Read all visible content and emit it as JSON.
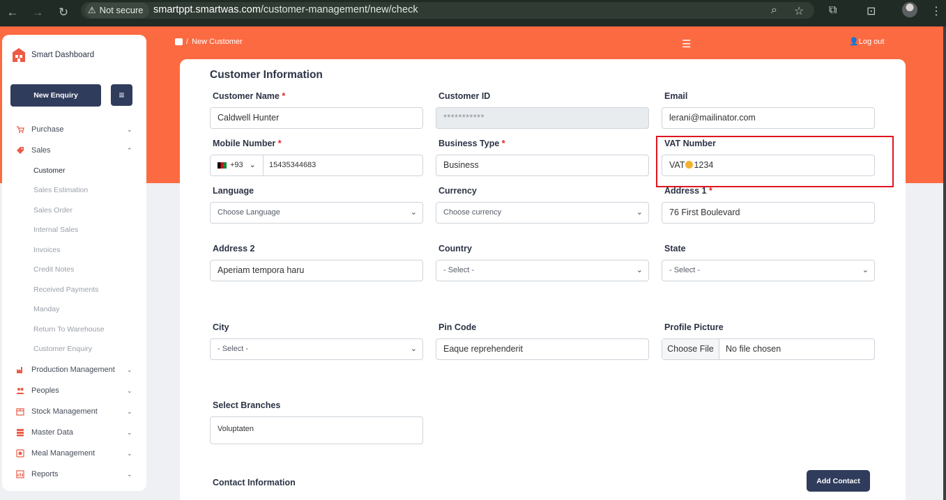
{
  "browser": {
    "security_label": "Not secure",
    "url_domain": "smartppt.smartwas.com",
    "url_path": "/customer-management/new/check"
  },
  "sidebar": {
    "brand": "Smart Dashboard",
    "new_enquiry": "New Enquiry",
    "items": [
      {
        "label": "Purchase"
      },
      {
        "label": "Sales"
      },
      {
        "label": "Production Management"
      },
      {
        "label": "Peoples"
      },
      {
        "label": "Stock Management"
      },
      {
        "label": "Master Data"
      },
      {
        "label": "Meal Management"
      },
      {
        "label": "Reports"
      }
    ],
    "sales_sub": [
      "Customer",
      "Sales Estimation",
      "Sales Order",
      "Internal Sales",
      "Invoices",
      "Credit Notes",
      "Received Payments",
      "Manday",
      "Return To Warehouse",
      "Customer Enquiry"
    ]
  },
  "header": {
    "breadcrumb": "New Customer",
    "logout": "Log out"
  },
  "form": {
    "title": "Customer Information",
    "customer_name": {
      "label": "Customer Name",
      "value": "Caldwell Hunter"
    },
    "customer_id": {
      "label": "Customer ID",
      "value": "***********"
    },
    "email": {
      "label": "Email",
      "value": "lerani@mailinator.com"
    },
    "mobile": {
      "label": "Mobile Number",
      "code": "+93",
      "value": "15435344683"
    },
    "business_type": {
      "label": "Business Type",
      "value": "Business"
    },
    "vat": {
      "label": "VAT Number",
      "value_prefix": "VAT",
      "value_suffix": "1234"
    },
    "language": {
      "label": "Language",
      "value": "Choose Language"
    },
    "currency": {
      "label": "Currency",
      "value": "Choose currency"
    },
    "address1": {
      "label": "Address 1",
      "value": "76 First Boulevard"
    },
    "address2": {
      "label": "Address 2",
      "value": "Aperiam tempora haru"
    },
    "country": {
      "label": "Country",
      "value": "- Select -"
    },
    "state": {
      "label": "State",
      "value": "- Select -"
    },
    "city": {
      "label": "City",
      "value": "- Select -"
    },
    "pin": {
      "label": "Pin Code",
      "value": "Eaque reprehenderit"
    },
    "picture": {
      "label": "Profile Picture",
      "button": "Choose File",
      "status": "No file chosen"
    },
    "branches": {
      "label": "Select Branches",
      "value": "Voluptaten"
    },
    "contact_title": "Contact Information",
    "add_contact": "Add Contact"
  }
}
